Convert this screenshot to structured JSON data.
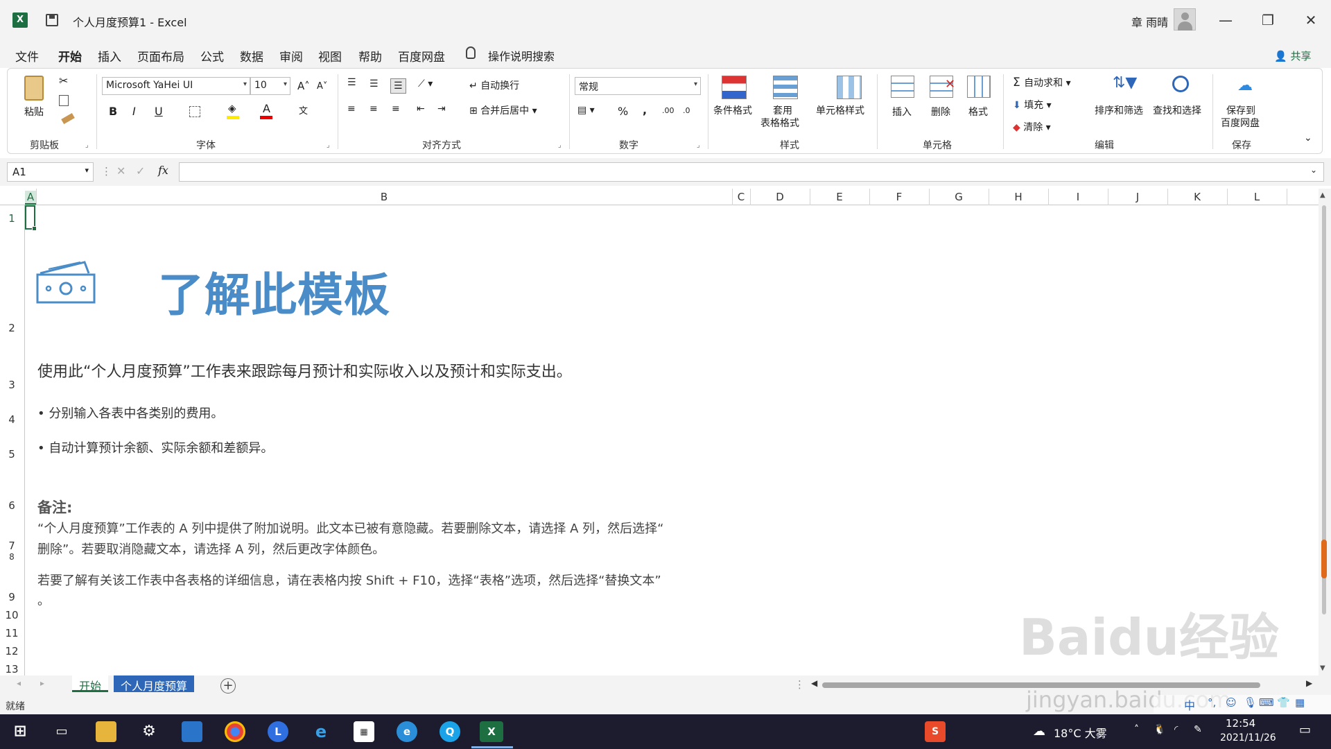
{
  "window": {
    "doc_title": "个人月度预算1  -  Excel",
    "user_name": "章 雨晴",
    "minimize": "—",
    "restore": "❐",
    "close": "✕"
  },
  "menu": {
    "items": [
      "文件",
      "开始",
      "插入",
      "页面布局",
      "公式",
      "数据",
      "审阅",
      "视图",
      "帮助",
      "百度网盘"
    ],
    "active": "开始",
    "search_label": "操作说明搜索",
    "share_label": "共享"
  },
  "ribbon": {
    "clipboard": {
      "paste": "粘贴",
      "label": "剪贴板"
    },
    "font": {
      "name": "Microsoft YaHei UI",
      "size": "10",
      "bold": "B",
      "italic": "I",
      "underline": "U",
      "label": "字体"
    },
    "alignment": {
      "wrap": "自动换行",
      "merge": "合并后居中",
      "label": "对齐方式"
    },
    "number": {
      "format": "常规",
      "percent": "%",
      "comma": ",",
      "label": "数字"
    },
    "styles": {
      "conditional": "条件格式",
      "table_line1": "套用",
      "table_line2": "表格格式",
      "cell_styles": "单元格样式",
      "label": "样式"
    },
    "cells": {
      "insert": "插入",
      "delete": "删除",
      "format": "格式",
      "label": "单元格"
    },
    "editing": {
      "autosum": "自动求和",
      "fill": "填充",
      "clear": "清除",
      "sort": "排序和筛选",
      "find": "查找和选择",
      "label": "编辑"
    },
    "save": {
      "line1": "保存到",
      "line2": "百度网盘",
      "label": "保存"
    }
  },
  "formula_bar": {
    "name_box": "A1",
    "fx": "fx",
    "value": ""
  },
  "columns": [
    "A",
    "B",
    "C",
    "D",
    "E",
    "F",
    "G",
    "H",
    "I",
    "J",
    "K",
    "L"
  ],
  "rows": [
    "1",
    "2",
    "3",
    "4",
    "5",
    "6",
    "7",
    "8",
    "9",
    "10",
    "11",
    "12",
    "13"
  ],
  "content": {
    "title": "了解此模板",
    "subtitle": "使用此“个人月度预算”工作表来跟踪每月预计和实际收入以及预计和实际支出。",
    "bullet1": "• 分别输入各表中各类别的费用。",
    "bullet2": "• 自动计算预计余额、实际余额和差额异。",
    "note_heading": "备注:",
    "note_line1": "“个人月度预算”工作表的 A 列中提供了附加说明。此文本已被有意隐藏。若要删除文本，请选择 A 列，然后选择“",
    "note_line2": "删除”。若要取消隐藏文本，请选择 A 列，然后更改字体颜色。",
    "note_line3": "若要了解有关该工作表中各表格的详细信息，请在表格内按 Shift + F10，选择“表格”选项，然后选择“替换文本”",
    "note_line4": "。"
  },
  "sheet_tabs": [
    "开始",
    "个人月度预算"
  ],
  "status": "就绪",
  "taskbar": {
    "weather": "18°C 大雾",
    "time": "12:54",
    "date": "2021/11/26",
    "ime": "中"
  },
  "watermark": {
    "main": "Baidu经验",
    "sub": "jingyan.baidu.com"
  },
  "colors": {
    "excel_green": "#1d6f42",
    "title_blue": "#4a8cc7",
    "tab_blue": "#2e66b8",
    "scroll_orange": "#e06a1c"
  }
}
